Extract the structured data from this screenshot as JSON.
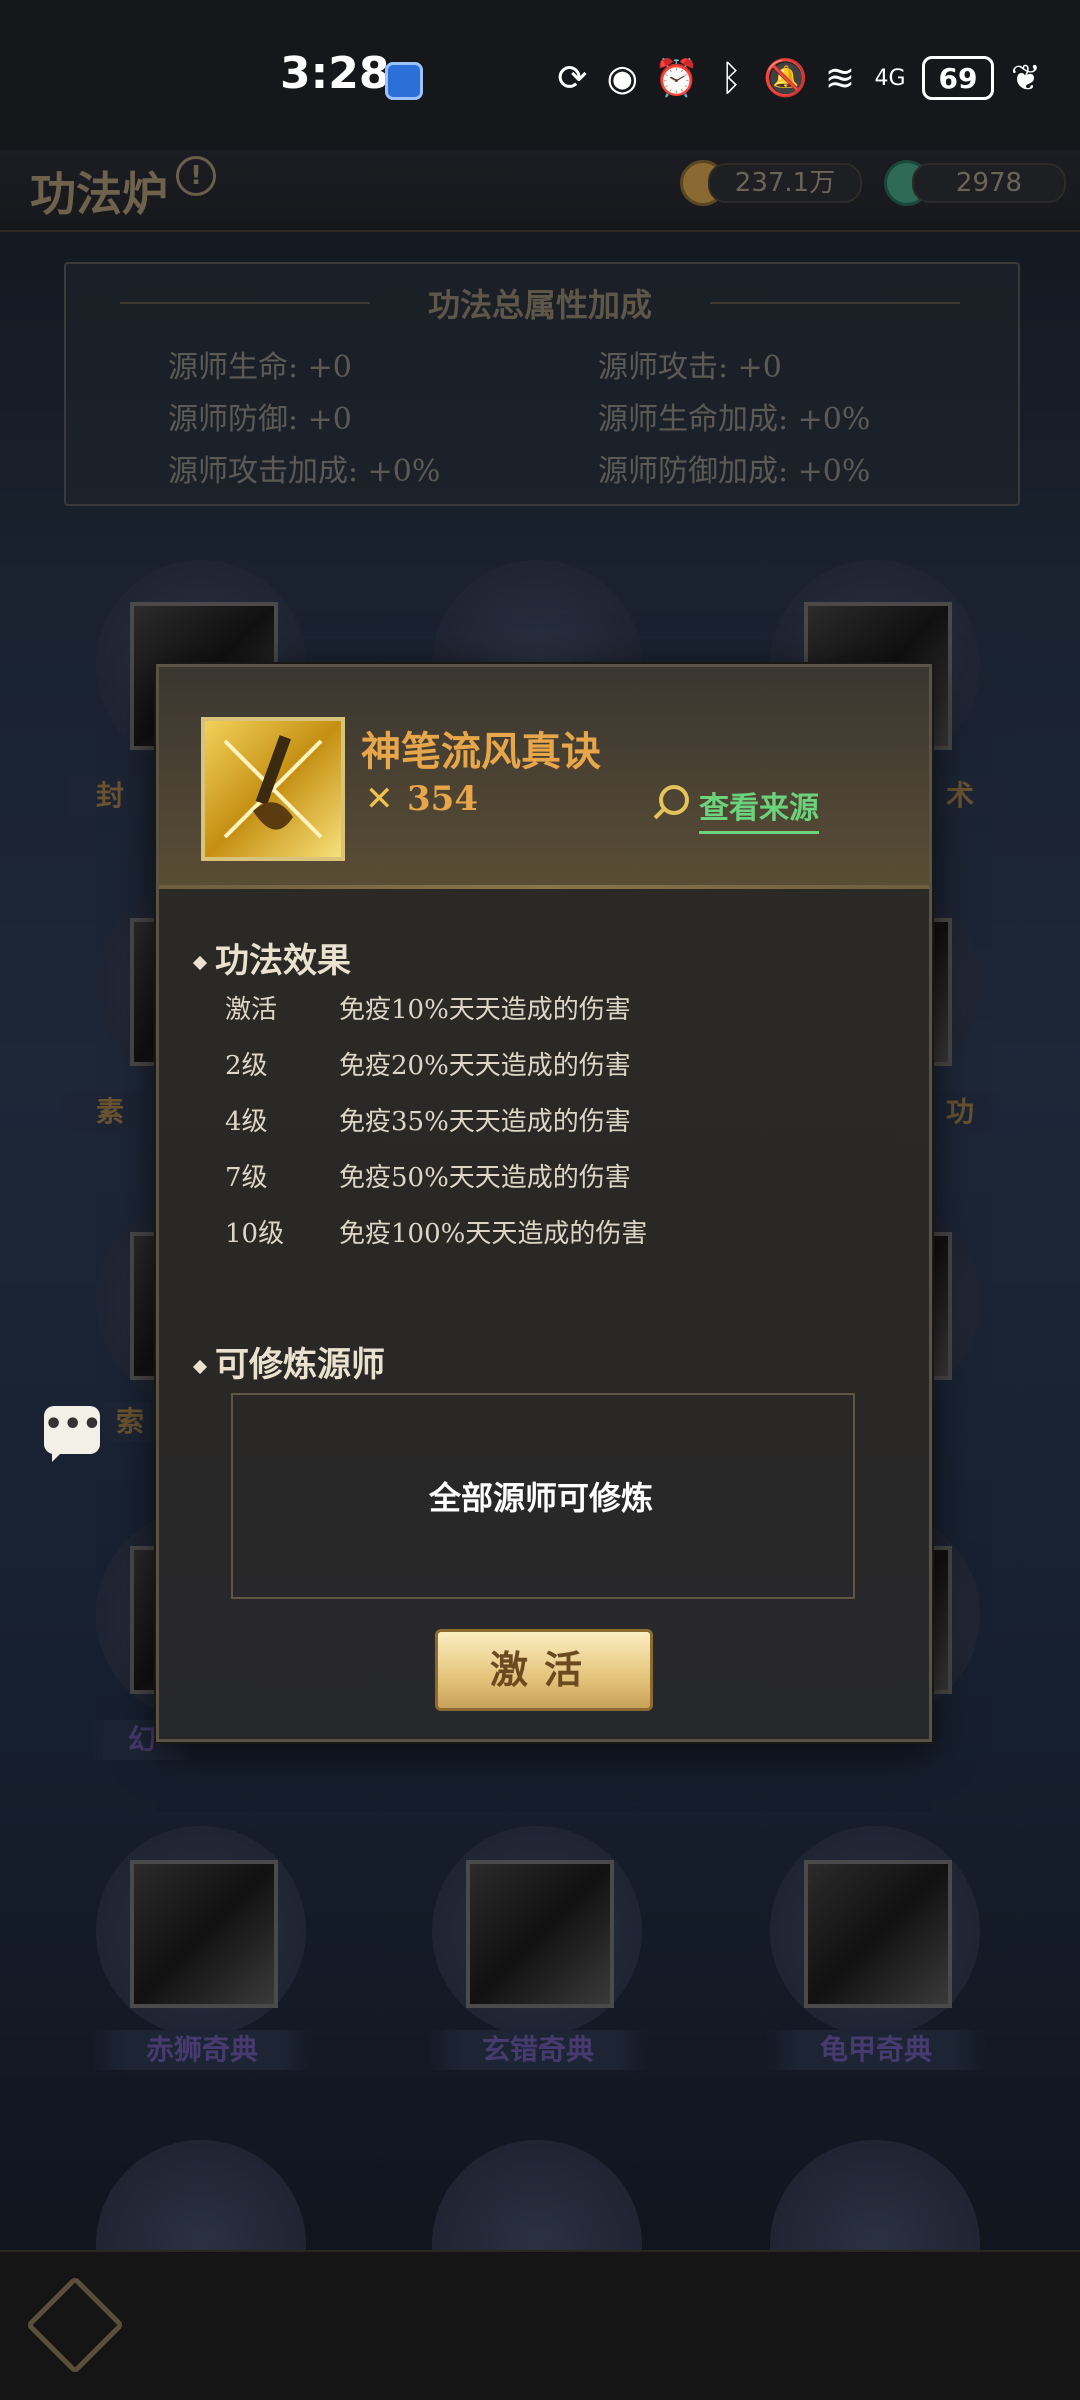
{
  "status_bar": {
    "time": "3:28",
    "battery": "69",
    "icons": [
      "mobile-data-icon",
      "eye-icon",
      "alarm-icon",
      "bluetooth-icon",
      "mute-icon",
      "wifi-icon",
      "4g-signal-icon",
      "battery-icon",
      "leaf-icon"
    ],
    "network_label": "4G"
  },
  "header": {
    "title": "功法炉",
    "info_glyph": "!",
    "currency": [
      {
        "name": "coin",
        "value": "237.1万",
        "color": "#a07a3a"
      },
      {
        "name": "jade",
        "value": "2978",
        "color": "#2e8a6a"
      }
    ]
  },
  "attributes": {
    "title": "功法总属性加成",
    "items": [
      "源师生命: +0",
      "源师攻击: +0",
      "源师防御: +0",
      "源师生命加成: +0%",
      "源师攻击加成: +0%",
      "源师防御加成: +0%"
    ]
  },
  "background_tiles": {
    "labels": [
      "封",
      "术",
      "素",
      "功",
      "索",
      "幻",
      "赤狮奇典",
      "玄错奇典",
      "龟甲奇典"
    ]
  },
  "modal": {
    "skill_name": "神笔流风真诀",
    "power": "354",
    "source_link": "查看来源",
    "effects_title": "功法效果",
    "effects": [
      {
        "level": "激活",
        "text": "免疫10%天天造成的伤害"
      },
      {
        "level": "2级",
        "text": "免疫20%天天造成的伤害"
      },
      {
        "level": "4级",
        "text": "免疫35%天天造成的伤害"
      },
      {
        "level": "7级",
        "text": "免疫50%天天造成的伤害"
      },
      {
        "level": "10级",
        "text": "免疫100%天天造成的伤害"
      }
    ],
    "trainable_title": "可修炼源师",
    "trainable_text": "全部源师可修炼",
    "activate_label": "激活"
  },
  "chat": {
    "glyph": "•••"
  },
  "colors": {
    "accent_gold": "#e8a64a",
    "link_green": "#6cd27c",
    "button_gold": "#e5c47c"
  }
}
